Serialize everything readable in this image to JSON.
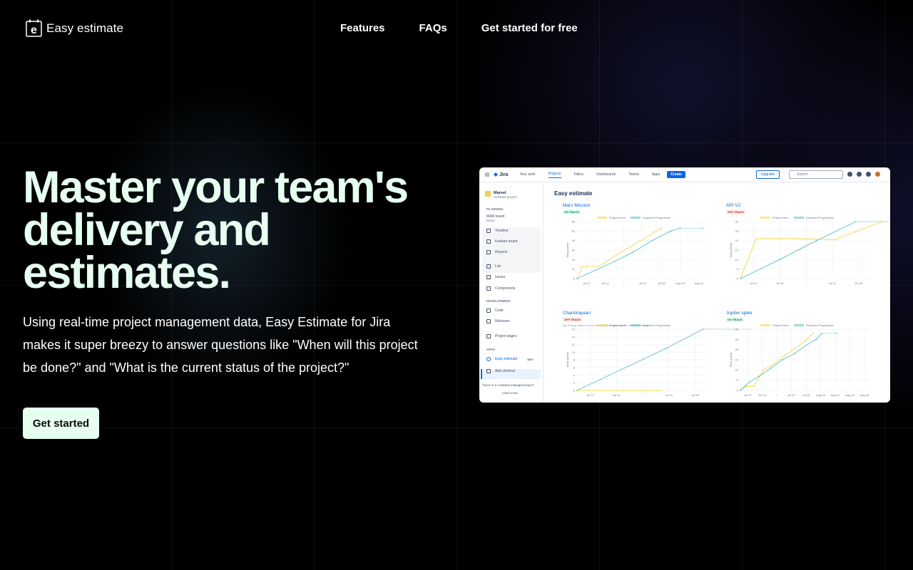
{
  "brand": {
    "name": "Easy estimate"
  },
  "nav": {
    "items": [
      "Features",
      "FAQs",
      "Get started for free"
    ]
  },
  "hero": {
    "title": "Master your team's delivery and estimates.",
    "subtitle": "Using real-time project management data, Easy Estimate for Jira makes it super breezy to answer questions like \"When will this project be done?\" and \"What is the current status of the project?\"",
    "cta": "Get started"
  },
  "colors": {
    "accent": "#e6fff0",
    "trend": "#f5d742",
    "expected": "#5bc0c4",
    "jira_blue": "#0c66e4"
  },
  "jira": {
    "brand": "Jira",
    "menu": [
      "Your work",
      "Projects",
      "Filters",
      "Dashboards",
      "Teams",
      "Apps"
    ],
    "create": "Create",
    "upgrade": "Upgrade",
    "search_placeholder": "Search",
    "project": {
      "name": "Marvel",
      "type": "Software project"
    },
    "sections": {
      "planning": "PLANNING",
      "development": "DEVELOPMENT",
      "apps": "APPS"
    },
    "board": {
      "name": "MAR board",
      "sub": "Board"
    },
    "board_items": [
      "Timeline",
      "Kanban board",
      "Reports"
    ],
    "items": [
      "List",
      "Issues",
      "Components"
    ],
    "dev_items": [
      "Code",
      "Releases"
    ],
    "project_pages": "Project pages",
    "app_items": {
      "easy": "Easy estimate",
      "easy_badge": "DEV",
      "shortcut": "Add shortcut"
    },
    "footer": {
      "managed": "You're in a company-managed project",
      "learn": "Learn more"
    },
    "main_title": "Easy estimate"
  },
  "chart_data": [
    {
      "type": "line",
      "title": "Mars Mission",
      "status": "ON TRACK",
      "ylabel": "Story points",
      "ylim": [
        0,
        60
      ],
      "yticks": [
        0,
        10,
        20,
        30,
        40,
        50,
        60
      ],
      "xticks": [
        "Jul 07",
        "Jul 14",
        "*",
        "Jul 21",
        "Jul 28",
        "Aug 04",
        "Aug 11"
      ],
      "series": [
        {
          "name": "Project trend",
          "points": [
            [
              0,
              0
            ],
            [
              0.3,
              13
            ],
            [
              1.2,
              13
            ],
            [
              2.2,
              26
            ],
            [
              4.5,
              53
            ]
          ]
        },
        {
          "name": "Expected Progression",
          "points": [
            [
              0,
              0
            ],
            [
              1,
              9
            ],
            [
              2,
              18
            ],
            [
              3,
              28
            ],
            [
              4,
              40
            ],
            [
              5,
              50
            ],
            [
              5.5,
              53
            ],
            [
              6.7,
              53
            ]
          ]
        }
      ]
    },
    {
      "type": "line",
      "title": "API V2",
      "status": "OFF TRACK",
      "ylabel": "Story points",
      "ylim": [
        0,
        30
      ],
      "yticks": [
        0,
        5,
        10,
        15,
        20,
        25,
        30
      ],
      "xticks": [
        "Jul 07",
        "Jul 14",
        "*",
        "Jul 21",
        "Jul 28"
      ],
      "series": [
        {
          "name": "Project trend",
          "points": [
            [
              0,
              0
            ],
            [
              0.6,
              21
            ],
            [
              2.2,
              21
            ],
            [
              3.6,
              20.5
            ],
            [
              5.4,
              30
            ]
          ]
        },
        {
          "name": "Expected Progression",
          "points": [
            [
              0,
              0
            ],
            [
              1.5,
              10
            ],
            [
              2.9,
              20
            ],
            [
              4.4,
              30
            ],
            [
              6.1,
              30
            ]
          ]
        }
      ]
    },
    {
      "type": "line",
      "title": "Chandrayaan",
      "status": "OFF TRACK",
      "note": "Not enough data or work completed to estimate the completion time",
      "ylabel": "Story points",
      "ylim": [
        0,
        16
      ],
      "yticks": [
        0,
        2,
        4,
        6,
        8,
        10,
        12,
        14,
        16
      ],
      "xticks": [
        "Jul 07",
        "Jul 14",
        "*",
        "Jul 21",
        "Jul 28"
      ],
      "series": [
        {
          "name": "Project trend",
          "points": [
            [
              0,
              0
            ],
            [
              3.2,
              0
            ]
          ]
        },
        {
          "name": "Expected Progression",
          "points": [
            [
              0,
              0
            ],
            [
              1.7,
              5.5
            ],
            [
              3.4,
              11
            ],
            [
              4.8,
              16
            ],
            [
              6.6,
              16
            ]
          ]
        }
      ]
    },
    {
      "type": "line",
      "title": "Jupiter spike",
      "status": "ON TRACK",
      "ylabel": "Story points",
      "ylim": [
        0,
        30
      ],
      "yticks": [
        0,
        5,
        10,
        15,
        20,
        25,
        30
      ],
      "xticks": [
        "Jul 07",
        "Jul 14",
        "*",
        "Jul 21",
        "Jul 28",
        "Aug 04",
        "Aug 11",
        "Aug 18",
        "Aug 25"
      ],
      "series": [
        {
          "name": "Project trend",
          "points": [
            [
              0,
              0
            ],
            [
              0.4,
              2
            ],
            [
              0.9,
              2
            ],
            [
              1.6,
              10
            ],
            [
              2.3,
              13
            ],
            [
              4.4,
              24
            ],
            [
              5,
              28
            ]
          ]
        },
        {
          "name": "Expected Progression",
          "points": [
            [
              0,
              0
            ],
            [
              0.6,
              4
            ],
            [
              1.3,
              7
            ],
            [
              2.1,
              11
            ],
            [
              2.9,
              15
            ],
            [
              3.7,
              18
            ],
            [
              4.5,
              22
            ],
            [
              5.2,
              25
            ],
            [
              5.6,
              28
            ],
            [
              6.6,
              28
            ]
          ]
        }
      ]
    }
  ]
}
